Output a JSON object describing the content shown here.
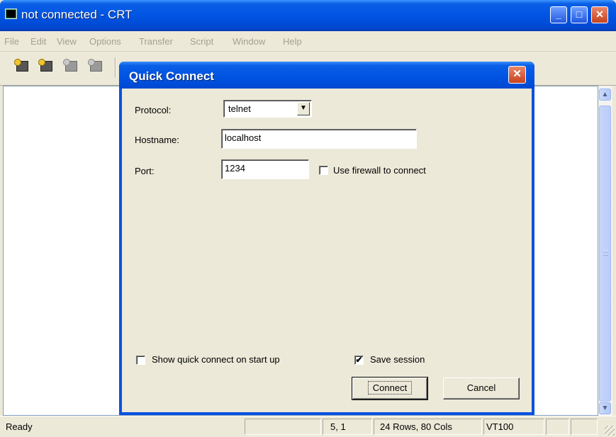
{
  "window": {
    "title": "not connected - CRT",
    "controls": {
      "minimize": "_",
      "maximize": "□",
      "close": "✕"
    }
  },
  "menu": [
    "File",
    "Edit",
    "View",
    "Options",
    "Transfer",
    "Script",
    "Window",
    "Help"
  ],
  "toolbar": {
    "icons": [
      "connect-icon",
      "quick-connect-icon",
      "reconnect-icon",
      "disconnect-icon"
    ]
  },
  "scrollbar": {
    "up_arrow": "▲",
    "down_arrow": "▼"
  },
  "status_bar": {
    "status": "Ready",
    "cursor_position": "5,  1",
    "size": "24 Rows,  80 Cols",
    "emulation": "VT100"
  },
  "dialog": {
    "title": "Quick Connect",
    "close_glyph": "✕",
    "protocol_label": "Protocol:",
    "protocol_value": "telnet",
    "dropdown_arrow": "▼",
    "hostname_label": "Hostname:",
    "hostname_value": "localhost",
    "port_label": "Port:",
    "port_value": "1234",
    "firewall_label": "Use firewall to connect",
    "firewall_checked": false,
    "show_on_startup_label": "Show quick connect on start up",
    "show_on_startup_checked": false,
    "save_session_label": "Save session",
    "save_session_checked": true,
    "check_glyph": "✔",
    "connect_label": "Connect",
    "cancel_label": "Cancel"
  }
}
